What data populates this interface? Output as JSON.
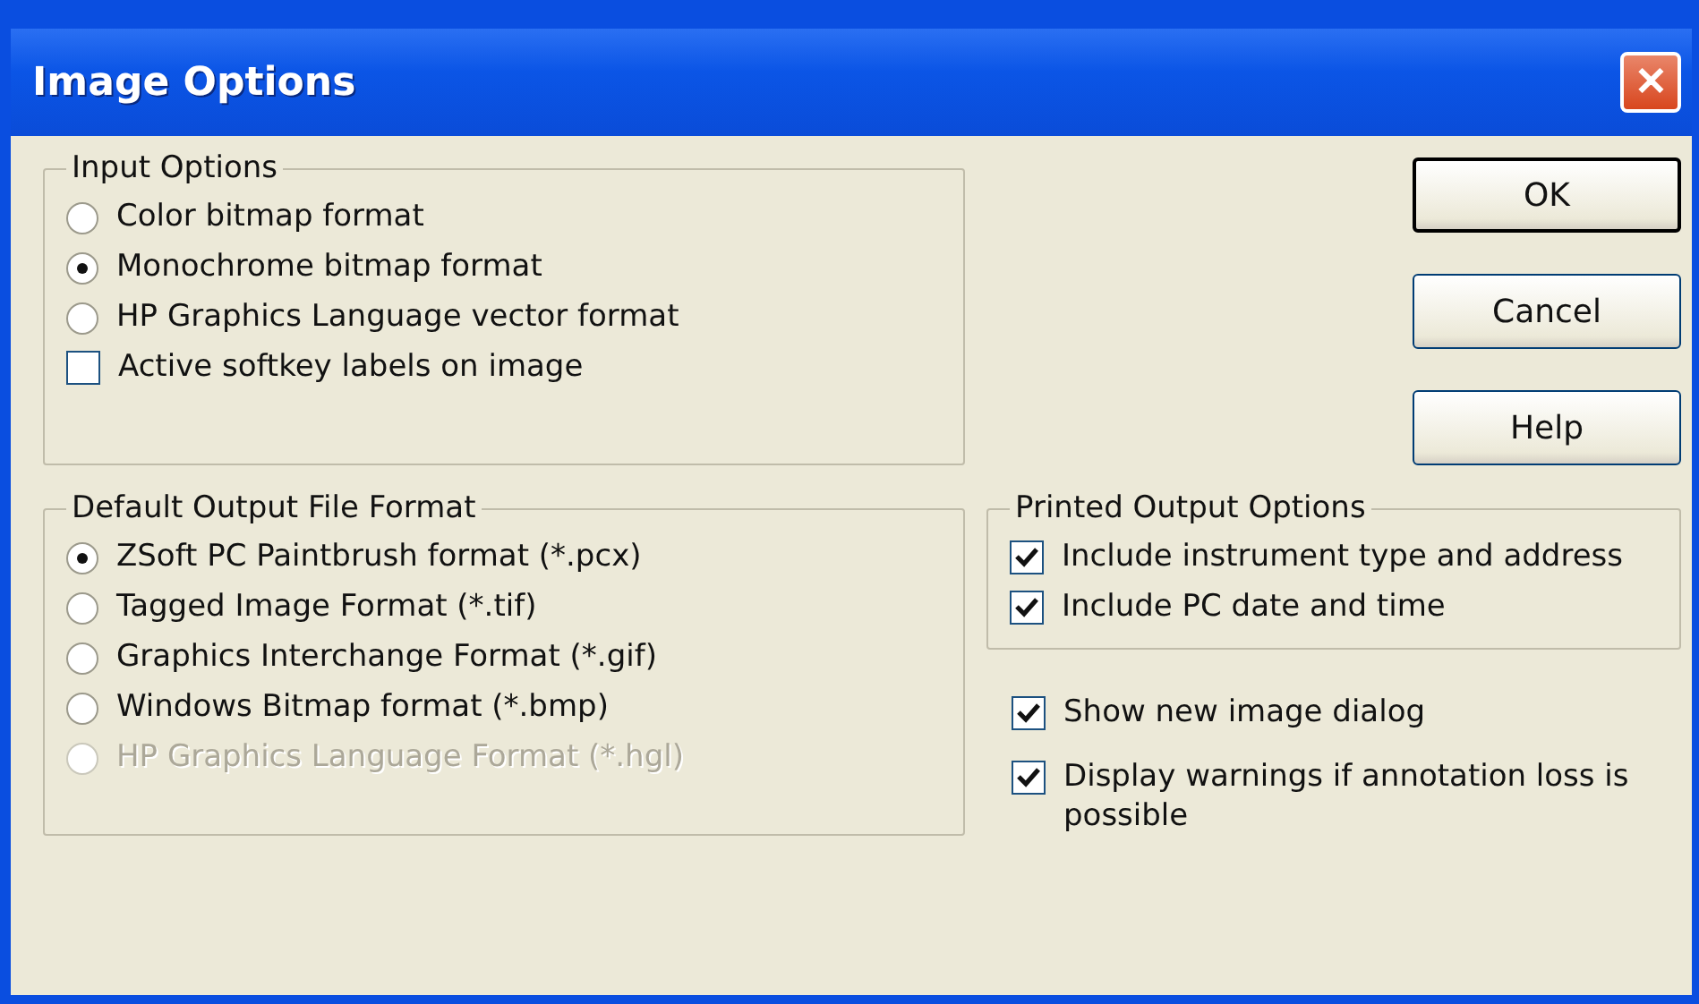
{
  "window": {
    "title": "Image Options",
    "close_label": "✕"
  },
  "input_options": {
    "title": "Input Options",
    "items": [
      {
        "kind": "radio",
        "label": "Color bitmap format",
        "selected": false,
        "disabled": false
      },
      {
        "kind": "radio",
        "label": "Monochrome bitmap format",
        "selected": true,
        "disabled": false
      },
      {
        "kind": "radio",
        "label": "HP Graphics Language vector format",
        "selected": false,
        "disabled": false
      },
      {
        "kind": "checkbox",
        "label": "Active softkey labels on image",
        "checked": false,
        "disabled": false
      }
    ]
  },
  "buttons": [
    {
      "label": "OK",
      "default": true
    },
    {
      "label": "Cancel",
      "default": false
    },
    {
      "label": "Help",
      "default": false
    }
  ],
  "output_format": {
    "title": "Default Output File Format",
    "items": [
      {
        "kind": "radio",
        "label": "ZSoft PC Paintbrush format (*.pcx)",
        "selected": true,
        "disabled": false
      },
      {
        "kind": "radio",
        "label": "Tagged Image Format (*.tif)",
        "selected": false,
        "disabled": false
      },
      {
        "kind": "radio",
        "label": "Graphics Interchange Format (*.gif)",
        "selected": false,
        "disabled": false
      },
      {
        "kind": "radio",
        "label": "Windows Bitmap format (*.bmp)",
        "selected": false,
        "disabled": false
      },
      {
        "kind": "radio",
        "label": "HP Graphics Language Format (*.hgl)",
        "selected": false,
        "disabled": true
      }
    ]
  },
  "printed_options": {
    "title": "Printed Output Options",
    "items": [
      {
        "kind": "checkbox",
        "label": "Include instrument type and address",
        "checked": true,
        "disabled": false
      },
      {
        "kind": "checkbox",
        "label": "Include PC date and time",
        "checked": true,
        "disabled": false
      }
    ]
  },
  "extra_options": [
    {
      "kind": "checkbox",
      "label": "Show new image dialog",
      "checked": true,
      "disabled": false
    },
    {
      "kind": "checkbox",
      "label": "Display warnings if annotation loss is possible",
      "checked": true,
      "disabled": false
    }
  ]
}
